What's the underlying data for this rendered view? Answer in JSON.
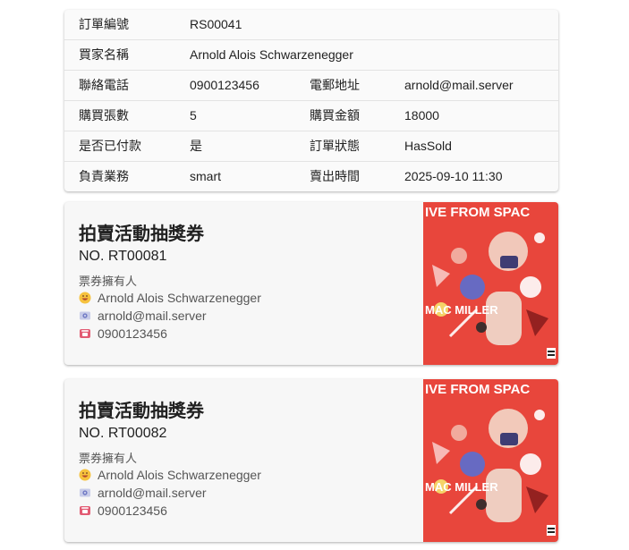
{
  "order": {
    "rows": [
      {
        "l1": "訂單編號",
        "v1": "RS00041",
        "l2": "",
        "v2": ""
      },
      {
        "l1": "買家名稱",
        "v1": "Arnold Alois Schwarzenegger",
        "l2": "",
        "v2": ""
      },
      {
        "l1": "聯絡電話",
        "v1": "0900123456",
        "l2": "電郵地址",
        "v2": "arnold@mail.server"
      },
      {
        "l1": "購買張數",
        "v1": "5",
        "l2": "購買金額",
        "v2": "18000"
      },
      {
        "l1": "是否已付款",
        "v1": "是",
        "l2": "訂單狀態",
        "v2": "HasSold"
      },
      {
        "l1": "負責業務",
        "v1": "smart",
        "l2": "賣出時間",
        "v2": "2025-09-10 11:30"
      }
    ]
  },
  "tickets": [
    {
      "title": "拍賣活動抽獎券",
      "no": "NO. RT00081",
      "owner_label": "票券擁有人",
      "name": "Arnold Alois Schwarzenegger",
      "email": "arnold@mail.server",
      "phone": "0900123456",
      "art_text": "IVE FROM SPAC",
      "art_name": "MAC MILLER"
    },
    {
      "title": "拍賣活動抽獎券",
      "no": "NO. RT00082",
      "owner_label": "票券擁有人",
      "name": "Arnold Alois Schwarzenegger",
      "email": "arnold@mail.server",
      "phone": "0900123456",
      "art_text": "IVE FROM SPAC",
      "art_name": "MAC MILLER"
    }
  ],
  "icons": {
    "name": "smiley-icon",
    "email": "envelope-icon",
    "phone": "telephone-icon"
  },
  "colors": {
    "art_bg": "#e8463c",
    "card_bg": "#f7f7f7"
  }
}
